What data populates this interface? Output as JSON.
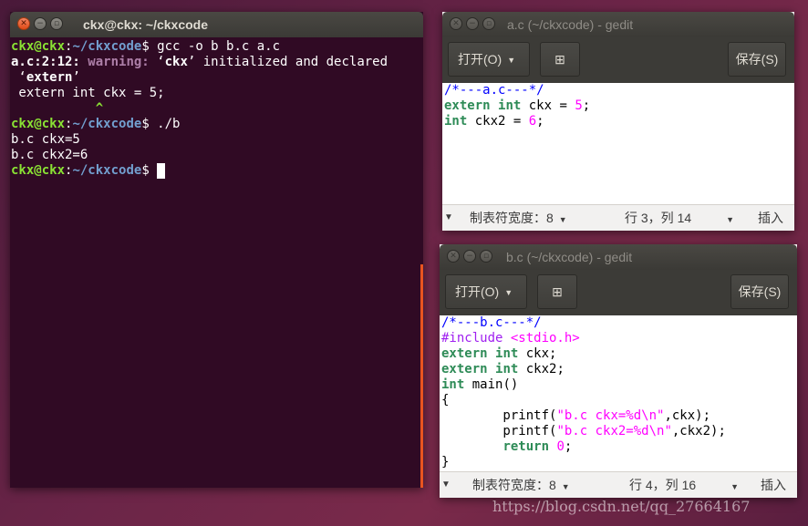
{
  "terminal": {
    "title": "ckx@ckx: ~/ckxcode",
    "lines": [
      [
        [
          "g",
          "ckx@ckx"
        ],
        [
          "w",
          ":"
        ],
        [
          "b",
          "~/ckxcode"
        ],
        [
          "w",
          "$ gcc -o b b.c a.c"
        ]
      ],
      [
        [
          "wb",
          "a.c:2:12: "
        ],
        [
          "m",
          "warning: "
        ],
        [
          "w",
          "‘"
        ],
        [
          "wb",
          "ckx"
        ],
        [
          "w",
          "’ initialized and declared"
        ]
      ],
      [
        [
          "w",
          " ‘"
        ],
        [
          "wb",
          "extern"
        ],
        [
          "w",
          "’"
        ]
      ],
      [
        [
          "w",
          " extern int ckx = 5;"
        ]
      ],
      [
        [
          "w",
          "           "
        ],
        [
          "g",
          "^"
        ]
      ],
      [
        [
          "g",
          "ckx@ckx"
        ],
        [
          "w",
          ":"
        ],
        [
          "b",
          "~/ckxcode"
        ],
        [
          "w",
          "$ ./b"
        ]
      ],
      [
        [
          "w",
          "b.c ckx=5"
        ]
      ],
      [
        [
          "w",
          "b.c ckx2=6"
        ]
      ],
      [
        [
          "g",
          "ckx@ckx"
        ],
        [
          "w",
          ":"
        ],
        [
          "b",
          "~/ckxcode"
        ],
        [
          "w",
          "$ "
        ]
      ]
    ]
  },
  "gedit_a": {
    "title": "a.c (~/ckxcode) - gedit",
    "open_label": "打开(O)",
    "save_label": "保存(S)",
    "tab_width": "制表符宽度：8",
    "position": "行 3，列 14",
    "mode": "插入",
    "lines": [
      [
        [
          "cmt",
          "/*---a.c---*/"
        ]
      ],
      [
        [
          "kw",
          "extern"
        ],
        [
          "t",
          " "
        ],
        [
          "kw",
          "int"
        ],
        [
          "t",
          " ckx = "
        ],
        [
          "num",
          "5"
        ],
        [
          "t",
          ";"
        ]
      ],
      [
        [
          "kw",
          "int"
        ],
        [
          "t",
          " ckx2 = "
        ],
        [
          "num",
          "6"
        ],
        [
          "t",
          ";"
        ]
      ]
    ]
  },
  "gedit_b": {
    "title": "b.c (~/ckxcode) - gedit",
    "open_label": "打开(O)",
    "save_label": "保存(S)",
    "tab_width": "制表符宽度：8",
    "position": "行 4，列 16",
    "mode": "插入",
    "lines": [
      [
        [
          "cmt",
          "/*---b.c---*/"
        ]
      ],
      [
        [
          "pp",
          "#include "
        ],
        [
          "str",
          "<stdio.h>"
        ]
      ],
      [
        [
          "kw",
          "extern"
        ],
        [
          "t",
          " "
        ],
        [
          "kw",
          "int"
        ],
        [
          "t",
          " ckx;"
        ]
      ],
      [
        [
          "kw",
          "extern"
        ],
        [
          "t",
          " "
        ],
        [
          "kw",
          "int"
        ],
        [
          "t",
          " ckx2;"
        ]
      ],
      [
        [
          "kw",
          "int"
        ],
        [
          "t",
          " main()"
        ]
      ],
      [
        [
          "t",
          "{"
        ]
      ],
      [
        [
          "t",
          "        printf("
        ],
        [
          "str",
          "\"b.c ckx=%d\\n\""
        ],
        [
          "t",
          ",ckx);"
        ]
      ],
      [
        [
          "t",
          "        printf("
        ],
        [
          "str",
          "\"b.c ckx2=%d\\n\""
        ],
        [
          "t",
          ",ckx2);"
        ]
      ],
      [
        [
          "t",
          "        "
        ],
        [
          "kw",
          "return"
        ],
        [
          "t",
          " "
        ],
        [
          "num",
          "0"
        ],
        [
          "t",
          ";"
        ]
      ],
      [
        [
          "t",
          "}"
        ]
      ]
    ]
  },
  "watermark": "https://blog.csdn.net/qq_27664167",
  "colors": {
    "terminal_bg": "#300a24",
    "prompt_user": "#8ae234",
    "prompt_path": "#729fcf",
    "warning": "#ad7fa8",
    "accent": "#e95420"
  }
}
